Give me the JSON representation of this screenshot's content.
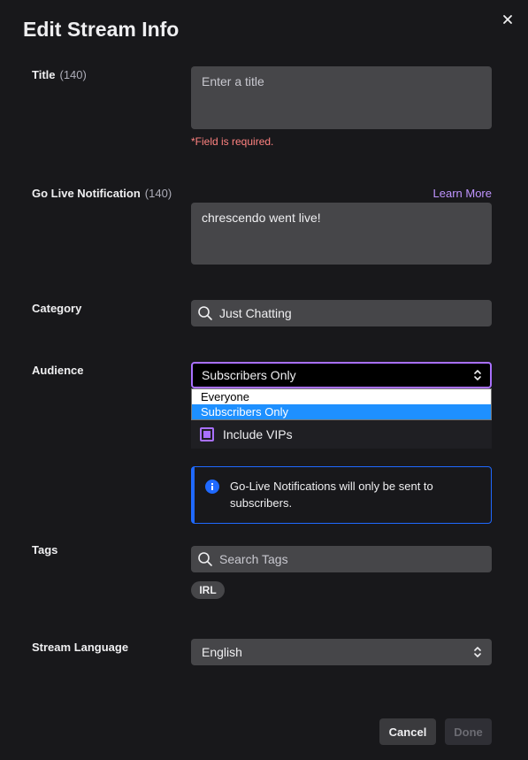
{
  "header": {
    "title": "Edit Stream Info"
  },
  "title_field": {
    "label": "Title",
    "count": "(140)",
    "placeholder": "Enter a title",
    "error": "*Field is required."
  },
  "notification": {
    "label": "Go Live Notification",
    "count": "(140)",
    "learn_more": "Learn More",
    "value": "chrescendo went live!"
  },
  "category": {
    "label": "Category",
    "value": "Just Chatting"
  },
  "audience": {
    "label": "Audience",
    "selected": "Subscribers Only",
    "options": [
      "Everyone",
      "Subscribers Only"
    ],
    "include_vips": "Include VIPs",
    "include_vips_checked": true,
    "info": "Go-Live Notifications will only be sent to subscribers."
  },
  "tags": {
    "label": "Tags",
    "placeholder": "Search Tags",
    "items": [
      "IRL"
    ]
  },
  "language": {
    "label": "Stream Language",
    "value": "English"
  },
  "footer": {
    "cancel": "Cancel",
    "done": "Done"
  },
  "colors": {
    "accent": "#a970ff",
    "info": "#1f69ff",
    "error": "#ff8280",
    "link": "#bf94ff"
  }
}
